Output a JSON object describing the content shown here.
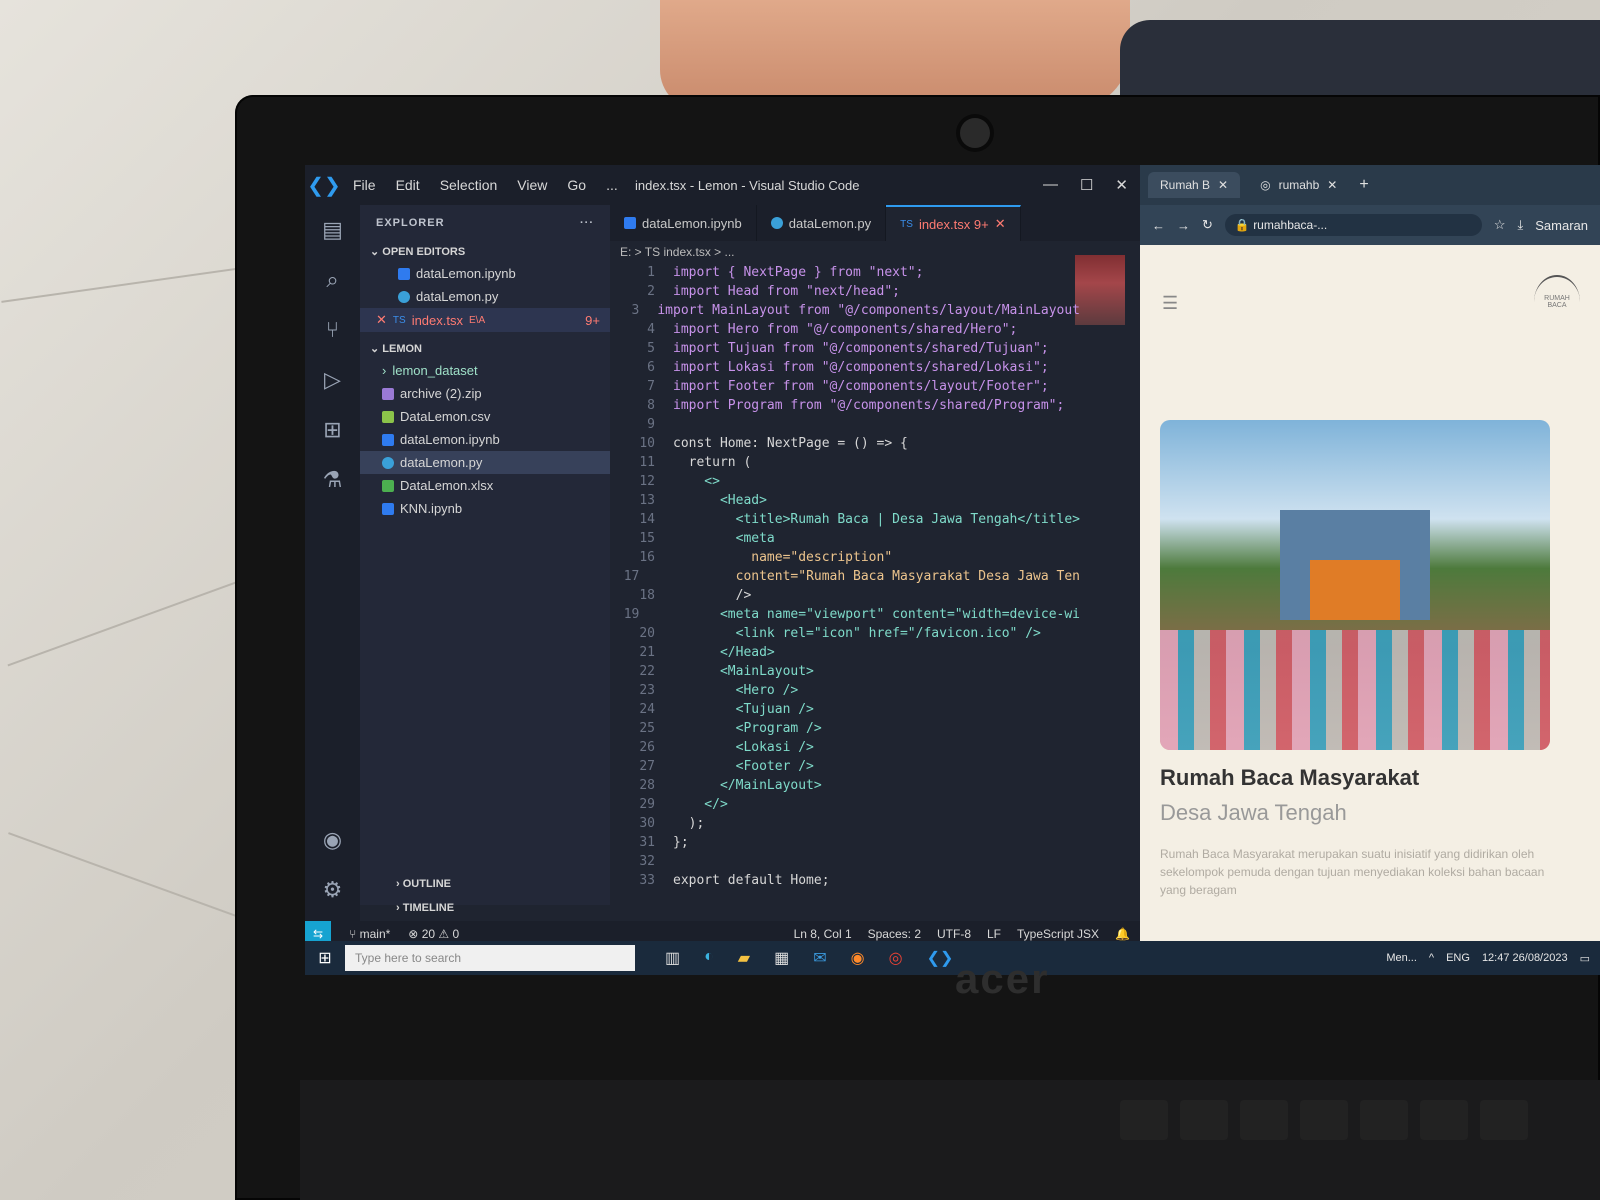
{
  "vscode": {
    "window_title": "index.tsx - Lemon - Visual Studio Code",
    "menu": [
      "File",
      "Edit",
      "Selection",
      "View",
      "Go",
      "..."
    ],
    "explorer_title": "EXPLORER",
    "open_editors_label": "OPEN EDITORS",
    "open_editors": [
      {
        "name": "dataLemon.ipynb"
      },
      {
        "name": "dataLemon.py"
      },
      {
        "name": "index.tsx",
        "badge": "9+",
        "tag": "E\\A"
      }
    ],
    "folder_label": "LEMON",
    "files": [
      {
        "name": "lemon_dataset"
      },
      {
        "name": "archive (2).zip"
      },
      {
        "name": "DataLemon.csv"
      },
      {
        "name": "dataLemon.ipynb"
      },
      {
        "name": "dataLemon.py"
      },
      {
        "name": "DataLemon.xlsx"
      },
      {
        "name": "KNN.ipynb"
      }
    ],
    "outline_label": "OUTLINE",
    "timeline_label": "TIMELINE",
    "tabs": [
      {
        "label": "dataLemon.ipynb"
      },
      {
        "label": "dataLemon.py"
      },
      {
        "label": "index.tsx 9+"
      }
    ],
    "breadcrumb": "E: > TS index.tsx > ...",
    "code_lines": [
      "import { NextPage } from \"next\";",
      "import Head from \"next/head\";",
      "import MainLayout from \"@/components/layout/MainLayout",
      "import Hero from \"@/components/shared/Hero\";",
      "import Tujuan from \"@/components/shared/Tujuan\";",
      "import Lokasi from \"@/components/shared/Lokasi\";",
      "import Footer from \"@/components/layout/Footer\";",
      "import Program from \"@/components/shared/Program\";",
      "",
      "const Home: NextPage = () => {",
      "  return (",
      "    <>",
      "      <Head>",
      "        <title>Rumah Baca | Desa Jawa Tengah</title>",
      "        <meta",
      "          name=\"description\"",
      "          content=\"Rumah Baca Masyarakat Desa Jawa Ten",
      "        />",
      "        <meta name=\"viewport\" content=\"width=device-wi",
      "        <link rel=\"icon\" href=\"/favicon.ico\" />",
      "      </Head>",
      "      <MainLayout>",
      "        <Hero />",
      "        <Tujuan />",
      "        <Program />",
      "        <Lokasi />",
      "        <Footer />",
      "      </MainLayout>",
      "    </>",
      "  );",
      "};",
      "",
      "export default Home;"
    ],
    "status": {
      "branch": "main*",
      "errors": "20",
      "warnings": "0",
      "position": "Ln 8, Col 1",
      "spaces": "Spaces: 2",
      "encoding": "UTF-8",
      "eol": "LF",
      "language": "TypeScript JSX"
    }
  },
  "browser": {
    "tabs": [
      {
        "label": "Rumah B"
      },
      {
        "label": "rumahb"
      }
    ],
    "url": "rumahbaca-...",
    "profile": "Samaran",
    "site_title": "Rumah Baca Masyarakat",
    "site_subtitle": "Desa Jawa Tengah",
    "paragraph": "Rumah Baca Masyarakat merupakan suatu inisiatif yang didirikan oleh sekelompok pemuda dengan tujuan menyediakan koleksi bahan bacaan yang beragam",
    "logo_text": "RUMAH BACA"
  },
  "taskbar": {
    "search_placeholder": "Type here to search",
    "weather": "Men...",
    "lang": "ENG",
    "time": "12:47",
    "date": "26/08/2023"
  },
  "laptop_brand": "acer"
}
